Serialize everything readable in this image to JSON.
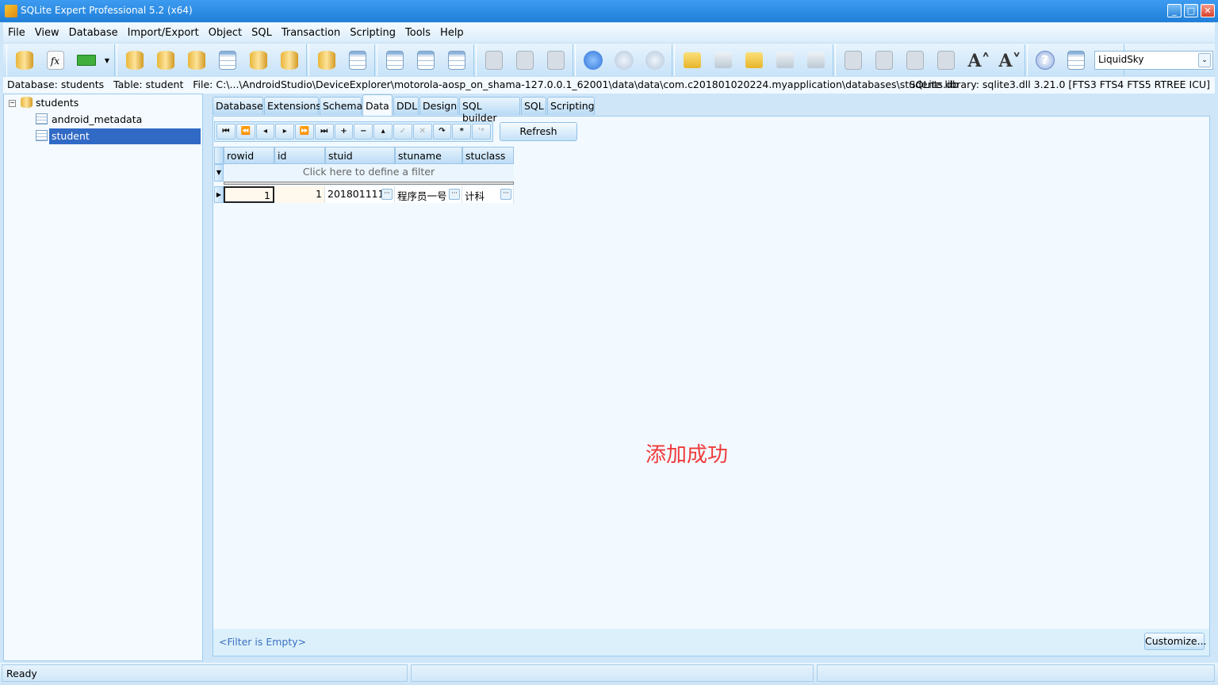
{
  "window": {
    "title": "SQLite Expert Professional 5.2 (x64)",
    "minimize": "_",
    "maximize": "□",
    "close": "✕"
  },
  "menu": [
    "File",
    "View",
    "Database",
    "Import/Export",
    "Object",
    "SQL",
    "Transaction",
    "Scripting",
    "Tools",
    "Help"
  ],
  "toolbar": {
    "groups": [
      [
        {
          "name": "attach-database-icon",
          "k": "db"
        },
        {
          "name": "function-icon",
          "k": "fx"
        },
        {
          "name": "exit-icon",
          "k": "exit"
        },
        {
          "name": "dropdown-arrow-icon",
          "k": "arr"
        }
      ],
      [
        {
          "name": "refresh-database-icon",
          "k": "db"
        },
        {
          "name": "check-database-icon",
          "k": "db"
        },
        {
          "name": "database-user-icon",
          "k": "db"
        },
        {
          "name": "table-tools-icon",
          "k": "tb"
        },
        {
          "name": "database-tools-icon",
          "k": "db"
        },
        {
          "name": "save-database-icon",
          "k": "db"
        }
      ],
      [
        {
          "name": "transfer-database-icon",
          "k": "db"
        },
        {
          "name": "import-table-icon",
          "k": "tb"
        }
      ],
      [
        {
          "name": "new-table-icon",
          "k": "tb"
        },
        {
          "name": "design-table-icon",
          "k": "tb"
        },
        {
          "name": "new-view-icon",
          "k": "tb"
        }
      ],
      [
        {
          "name": "sql-editor-icon",
          "k": "gy"
        },
        {
          "name": "commit-icon",
          "k": "gy"
        },
        {
          "name": "run-transaction-icon",
          "k": "gy"
        }
      ],
      [
        {
          "name": "play-icon",
          "k": "pl"
        },
        {
          "name": "step-icon",
          "k": "plg"
        },
        {
          "name": "back-icon",
          "k": "plg"
        }
      ],
      [
        {
          "name": "script-icon",
          "k": "sc"
        },
        {
          "name": "script-disabled-icon",
          "k": "scg"
        },
        {
          "name": "script-run-icon",
          "k": "sc"
        },
        {
          "name": "script-save-icon",
          "k": "scg"
        },
        {
          "name": "script-close-icon",
          "k": "scg"
        }
      ],
      [
        {
          "name": "gear-icon",
          "k": "gy"
        },
        {
          "name": "copy-icon",
          "k": "gy"
        },
        {
          "name": "paste-icon",
          "k": "gy"
        },
        {
          "name": "chart-icon",
          "k": "gy"
        },
        {
          "name": "font-increase-icon",
          "k": "ft",
          "g": "A˄"
        },
        {
          "name": "font-decrease-icon",
          "k": "ft",
          "g": "A˅"
        }
      ],
      [
        {
          "name": "help-icon",
          "k": "hl",
          "g": "?"
        },
        {
          "name": "download-update-icon",
          "k": "tb"
        },
        {
          "name": "info-icon",
          "k": "hl",
          "g": "i"
        }
      ]
    ],
    "skin": "LiquidSky"
  },
  "pathbar": {
    "left": "Database: students   Table: student   File: C:\\...\\AndroidStudio\\DeviceExplorer\\motorola-aosp_on_shama-127.0.0.1_62001\\data\\data\\com.c201801020224.myapplication\\databases\\students.db",
    "right": "SQLite library: sqlite3.dll 3.21.0 [FTS3 FTS4 FTS5 RTREE ICU]"
  },
  "tree": {
    "root": "students",
    "children": [
      "android_metadata",
      "student"
    ],
    "selected": "student"
  },
  "tabs": [
    "Database",
    "Extensions",
    "Schema",
    "Data",
    "DDL",
    "Design",
    "SQL builder",
    "SQL",
    "Scripting"
  ],
  "active_tab": "Data",
  "nav": [
    "⏮",
    "⏪",
    "◂",
    "▸",
    "⏩",
    "⏭",
    "+",
    "−",
    "▴",
    "✓",
    "✕",
    "↷",
    "*",
    "'*"
  ],
  "refresh": "Refresh",
  "grid": {
    "columns": [
      "rowid",
      "id",
      "stuid",
      "stuname",
      "stuclass"
    ],
    "filter_hint": "Click here to define a filter",
    "rows": [
      [
        "1",
        "1",
        "201801111",
        "程序员一号",
        "计科"
      ]
    ]
  },
  "message": "添加成功",
  "filter_status": "<Filter is Empty>",
  "customize": "Customize...",
  "status": "Ready",
  "colors": {
    "title": "#1f7fd8",
    "selection": "#316ac5",
    "message": "#f03a3a"
  }
}
